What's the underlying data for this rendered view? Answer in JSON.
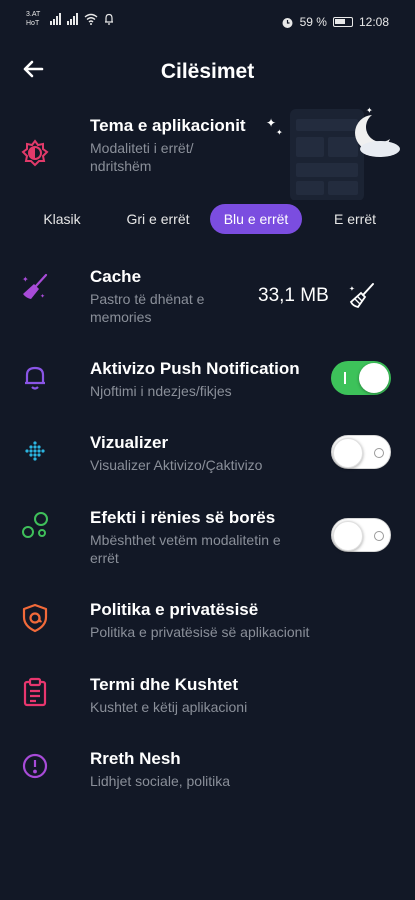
{
  "status": {
    "carrier": "3.AT HoT",
    "battery_percent": "59 %",
    "time": "12:08"
  },
  "header": {
    "title": "Cilësimet"
  },
  "theme": {
    "title": "Tema e aplikacionit",
    "subtitle": "Modaliteti i errët/ ndritshëm",
    "options": [
      "Klasik",
      "Gri e errët",
      "Blu e errët",
      "E errët"
    ],
    "selected": "Blu e errët"
  },
  "cache": {
    "title": "Cache",
    "subtitle": "Pastro të dhënat e memories",
    "size": "33,1 MB"
  },
  "push": {
    "title": "Aktivizo Push Notification",
    "subtitle": "Njoftimi i ndezjes/fikjes",
    "enabled": true
  },
  "visualizer": {
    "title": "Vizualizer",
    "subtitle": "Visualizer Aktivizo/Çaktivizo",
    "enabled": false
  },
  "snow": {
    "title": "Efekti i rënies së borës",
    "subtitle": "Mbështhet vetëm modalitetin e errët",
    "enabled": false
  },
  "privacy": {
    "title": "Politika e privatësisë",
    "subtitle": "Politika e privatësisë së aplikacionit"
  },
  "terms": {
    "title": "Termi dhe Kushtet",
    "subtitle": "Kushtet e këtij aplikacioni"
  },
  "about": {
    "title": "Rreth Nesh",
    "subtitle": "Lidhjet sociale, politika"
  },
  "colors": {
    "background": "#121826",
    "accent": "#7b4de0",
    "toggle_on": "#3dc25a",
    "icon_theme": "#e23a6a",
    "icon_cache": "#a84bd8",
    "icon_push": "#8a55e6",
    "icon_visualizer": "#2bb5e0",
    "icon_snow": "#3fbf5a",
    "icon_privacy": "#f26a3a",
    "icon_terms": "#e8366e",
    "icon_about": "#a84bd8"
  }
}
